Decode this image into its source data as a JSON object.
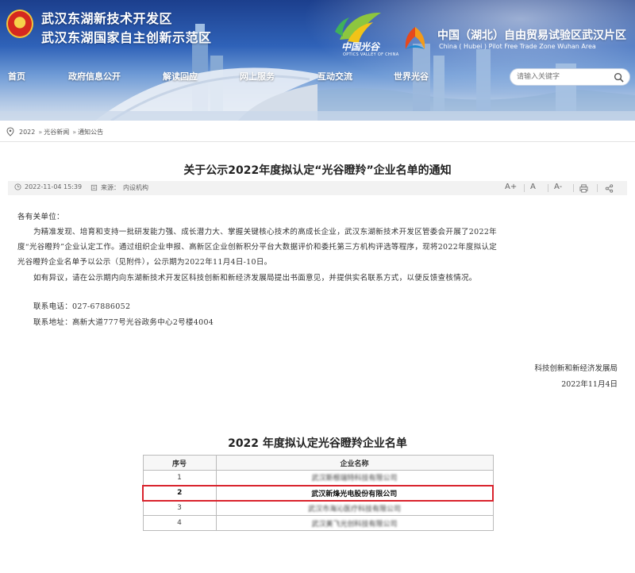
{
  "header": {
    "title_line1": "武汉东湖新技术开发区",
    "title_line2": "武汉东湖国家自主创新示范区",
    "logo_optics_cn": "中国光谷",
    "logo_optics_en": "OPTICS VALLEY OF CHINA",
    "ftz_title": "中国（湖北）自由贸易试验区武汉片区",
    "ftz_subtitle": "China ( Hubei ) Pilot Free Trade Zone Wuhan Area",
    "colors": {
      "title": "#ffffff",
      "sky_top": "#1c3f8d",
      "emblem_red": "#d5281f"
    }
  },
  "nav": {
    "items": [
      "首页",
      "政府信息公开",
      "解读回应",
      "网上服务",
      "互动交流",
      "世界光谷"
    ]
  },
  "search": {
    "placeholder": "请输入关键字",
    "icon": "search-icon"
  },
  "breadcrumb": {
    "items": [
      "2022",
      "光谷新闻",
      "通知公告"
    ],
    "separator": "»"
  },
  "article": {
    "title": "关于公示2022年度拟认定“光谷瞪羚”企业名单的通知",
    "date": "2022-11-04 15:39",
    "source_label": "来源：",
    "source": "内设机构",
    "tools": [
      "A+",
      "A",
      "A-",
      "print-icon",
      "share-icon"
    ],
    "salutation": "各有关单位：",
    "paragraphs": [
      "为精准发现、培育和支持一批研发能力强、成长潜力大、掌握关键核心技术的高成长企业，武汉东湖新技术开发区管委会开展了2022年",
      "度“光谷瞪羚”企业认定工作。通过组织企业申报、高新区企业创新积分平台大数据评价和委托第三方机构评选等程序，现将2022年度拟认定",
      "光谷瞪羚企业名单予以公示（见附件），公示期为2022年11月4日-10日。",
      "如有异议，请在公示期内向东湖新技术开发区科技创新和新经济发展局提出书面意见，并提供实名联系方式，以便反馈查核情况。"
    ],
    "contact_phone": "联系电话：027-67886052",
    "contact_address": "联系地址：高新大道777号光谷政务中心2号楼4004",
    "signature_org": "科技创新和新经济发展局",
    "signature_date": "2022年11月4日"
  },
  "attachment": {
    "title": "2022 年度拟认定光谷瞪羚企业名单",
    "headers": [
      "序号",
      "企业名称"
    ],
    "rows": [
      {
        "no": "1",
        "name": "武汉斯根瑞特科技有限公司"
      },
      {
        "no": "2",
        "name": "武汉新烽光电股份有限公司"
      },
      {
        "no": "3",
        "name": "武汉市海沁医疗科技有限公司"
      },
      {
        "no": "4",
        "name": "武汉美飞光创科技有限公司"
      }
    ],
    "highlight_color": "#d9232d"
  }
}
